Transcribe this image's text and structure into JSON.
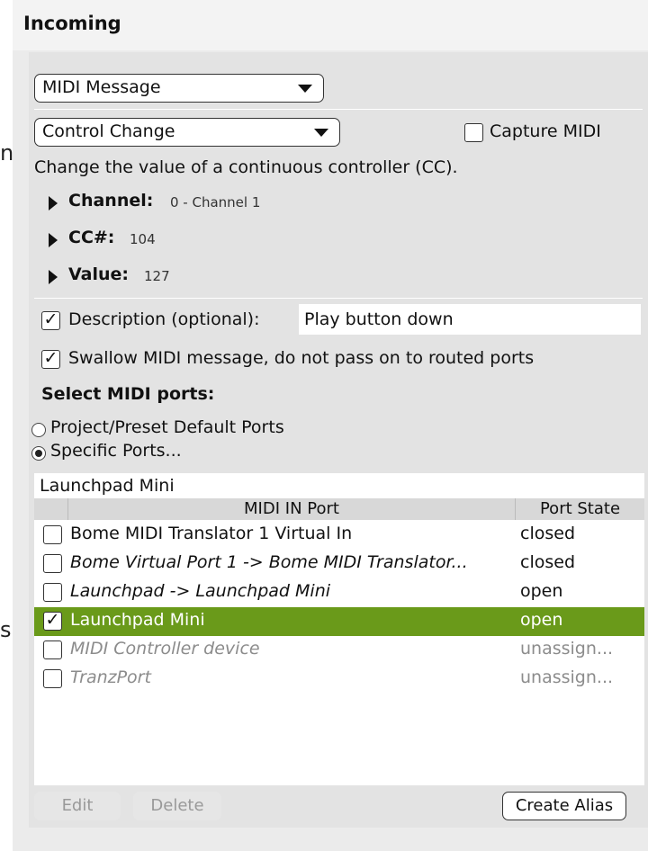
{
  "header": {
    "title": "Incoming"
  },
  "message_type": {
    "selected": "MIDI Message"
  },
  "message_subtype": {
    "selected": "Control Change"
  },
  "capture": {
    "label": "Capture MIDI",
    "checked": false
  },
  "help_text": "Change the value of a continuous controller (CC).",
  "params": [
    {
      "label": "Channel:",
      "value": "0 - Channel 1"
    },
    {
      "label": "CC#:",
      "value": "104"
    },
    {
      "label": "Value:",
      "value": "127"
    }
  ],
  "description": {
    "label": "Description (optional):",
    "checked": true,
    "value": "Play button down"
  },
  "swallow": {
    "label": "Swallow MIDI message, do not pass on to routed ports",
    "checked": true
  },
  "ports_heading": "Select MIDI ports:",
  "port_mode": {
    "options": [
      "Project/Preset Default Ports",
      "Specific Ports..."
    ],
    "selected": "Specific Ports..."
  },
  "port_filter": "Launchpad Mini",
  "port_table": {
    "headers": [
      "MIDI IN Port",
      "Port State"
    ],
    "rows": [
      {
        "name": "Bome MIDI Translator 1 Virtual In",
        "state": "closed",
        "checked": false,
        "style": "normal"
      },
      {
        "name": "Bome Virtual Port 1 -> Bome MIDI Translator...",
        "state": "closed",
        "checked": false,
        "style": "italic"
      },
      {
        "name": "Launchpad -> Launchpad Mini",
        "state": "open",
        "checked": false,
        "style": "italic"
      },
      {
        "name": "Launchpad Mini",
        "state": "open",
        "checked": true,
        "style": "selected"
      },
      {
        "name": "MIDI Controller device",
        "state": "unassign...",
        "checked": false,
        "style": "grey-italic"
      },
      {
        "name": "TranzPort",
        "state": "unassign...",
        "checked": false,
        "style": "grey-italic"
      }
    ]
  },
  "buttons": {
    "edit": "Edit",
    "delete": "Delete",
    "create_alias": "Create Alias"
  },
  "left_partial": {
    "glyph_top": "n",
    "glyph_bottom": "s"
  },
  "colors": {
    "selected_row": "#6a9a1a",
    "panel": "#e3e3e3"
  }
}
